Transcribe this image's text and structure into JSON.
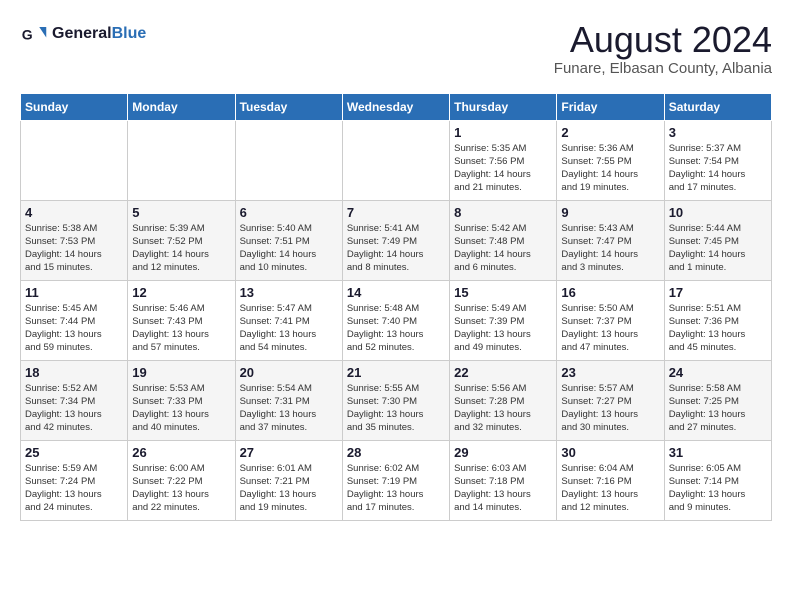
{
  "header": {
    "logo_general": "General",
    "logo_blue": "Blue",
    "month_title": "August 2024",
    "location": "Funare, Elbasan County, Albania"
  },
  "weekdays": [
    "Sunday",
    "Monday",
    "Tuesday",
    "Wednesday",
    "Thursday",
    "Friday",
    "Saturday"
  ],
  "weeks": [
    [
      {
        "day": "",
        "info": ""
      },
      {
        "day": "",
        "info": ""
      },
      {
        "day": "",
        "info": ""
      },
      {
        "day": "",
        "info": ""
      },
      {
        "day": "1",
        "info": "Sunrise: 5:35 AM\nSunset: 7:56 PM\nDaylight: 14 hours\nand 21 minutes."
      },
      {
        "day": "2",
        "info": "Sunrise: 5:36 AM\nSunset: 7:55 PM\nDaylight: 14 hours\nand 19 minutes."
      },
      {
        "day": "3",
        "info": "Sunrise: 5:37 AM\nSunset: 7:54 PM\nDaylight: 14 hours\nand 17 minutes."
      }
    ],
    [
      {
        "day": "4",
        "info": "Sunrise: 5:38 AM\nSunset: 7:53 PM\nDaylight: 14 hours\nand 15 minutes."
      },
      {
        "day": "5",
        "info": "Sunrise: 5:39 AM\nSunset: 7:52 PM\nDaylight: 14 hours\nand 12 minutes."
      },
      {
        "day": "6",
        "info": "Sunrise: 5:40 AM\nSunset: 7:51 PM\nDaylight: 14 hours\nand 10 minutes."
      },
      {
        "day": "7",
        "info": "Sunrise: 5:41 AM\nSunset: 7:49 PM\nDaylight: 14 hours\nand 8 minutes."
      },
      {
        "day": "8",
        "info": "Sunrise: 5:42 AM\nSunset: 7:48 PM\nDaylight: 14 hours\nand 6 minutes."
      },
      {
        "day": "9",
        "info": "Sunrise: 5:43 AM\nSunset: 7:47 PM\nDaylight: 14 hours\nand 3 minutes."
      },
      {
        "day": "10",
        "info": "Sunrise: 5:44 AM\nSunset: 7:45 PM\nDaylight: 14 hours\nand 1 minute."
      }
    ],
    [
      {
        "day": "11",
        "info": "Sunrise: 5:45 AM\nSunset: 7:44 PM\nDaylight: 13 hours\nand 59 minutes."
      },
      {
        "day": "12",
        "info": "Sunrise: 5:46 AM\nSunset: 7:43 PM\nDaylight: 13 hours\nand 57 minutes."
      },
      {
        "day": "13",
        "info": "Sunrise: 5:47 AM\nSunset: 7:41 PM\nDaylight: 13 hours\nand 54 minutes."
      },
      {
        "day": "14",
        "info": "Sunrise: 5:48 AM\nSunset: 7:40 PM\nDaylight: 13 hours\nand 52 minutes."
      },
      {
        "day": "15",
        "info": "Sunrise: 5:49 AM\nSunset: 7:39 PM\nDaylight: 13 hours\nand 49 minutes."
      },
      {
        "day": "16",
        "info": "Sunrise: 5:50 AM\nSunset: 7:37 PM\nDaylight: 13 hours\nand 47 minutes."
      },
      {
        "day": "17",
        "info": "Sunrise: 5:51 AM\nSunset: 7:36 PM\nDaylight: 13 hours\nand 45 minutes."
      }
    ],
    [
      {
        "day": "18",
        "info": "Sunrise: 5:52 AM\nSunset: 7:34 PM\nDaylight: 13 hours\nand 42 minutes."
      },
      {
        "day": "19",
        "info": "Sunrise: 5:53 AM\nSunset: 7:33 PM\nDaylight: 13 hours\nand 40 minutes."
      },
      {
        "day": "20",
        "info": "Sunrise: 5:54 AM\nSunset: 7:31 PM\nDaylight: 13 hours\nand 37 minutes."
      },
      {
        "day": "21",
        "info": "Sunrise: 5:55 AM\nSunset: 7:30 PM\nDaylight: 13 hours\nand 35 minutes."
      },
      {
        "day": "22",
        "info": "Sunrise: 5:56 AM\nSunset: 7:28 PM\nDaylight: 13 hours\nand 32 minutes."
      },
      {
        "day": "23",
        "info": "Sunrise: 5:57 AM\nSunset: 7:27 PM\nDaylight: 13 hours\nand 30 minutes."
      },
      {
        "day": "24",
        "info": "Sunrise: 5:58 AM\nSunset: 7:25 PM\nDaylight: 13 hours\nand 27 minutes."
      }
    ],
    [
      {
        "day": "25",
        "info": "Sunrise: 5:59 AM\nSunset: 7:24 PM\nDaylight: 13 hours\nand 24 minutes."
      },
      {
        "day": "26",
        "info": "Sunrise: 6:00 AM\nSunset: 7:22 PM\nDaylight: 13 hours\nand 22 minutes."
      },
      {
        "day": "27",
        "info": "Sunrise: 6:01 AM\nSunset: 7:21 PM\nDaylight: 13 hours\nand 19 minutes."
      },
      {
        "day": "28",
        "info": "Sunrise: 6:02 AM\nSunset: 7:19 PM\nDaylight: 13 hours\nand 17 minutes."
      },
      {
        "day": "29",
        "info": "Sunrise: 6:03 AM\nSunset: 7:18 PM\nDaylight: 13 hours\nand 14 minutes."
      },
      {
        "day": "30",
        "info": "Sunrise: 6:04 AM\nSunset: 7:16 PM\nDaylight: 13 hours\nand 12 minutes."
      },
      {
        "day": "31",
        "info": "Sunrise: 6:05 AM\nSunset: 7:14 PM\nDaylight: 13 hours\nand 9 minutes."
      }
    ]
  ]
}
